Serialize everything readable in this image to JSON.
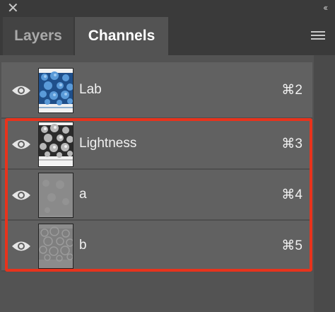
{
  "window": {
    "close_icon": "close-icon",
    "collapse_icon": "double-chevron-left-icon",
    "collapse_glyph": "‹‹"
  },
  "tabs": [
    {
      "label": "Layers",
      "active": false
    },
    {
      "label": "Channels",
      "active": true
    }
  ],
  "panel_menu_icon": "hamburger-menu-icon",
  "channels": [
    {
      "name": "Lab",
      "shortcut": "⌘2",
      "visible": true,
      "thumbnail": "color-blue-texture"
    },
    {
      "name": "Lightness",
      "shortcut": "⌘3",
      "visible": true,
      "thumbnail": "grayscale-texture"
    },
    {
      "name": "a",
      "shortcut": "⌘4",
      "visible": true,
      "thumbnail": "flat-gray-noise"
    },
    {
      "name": "b",
      "shortcut": "⌘5",
      "visible": true,
      "thumbnail": "flat-gray-pattern"
    }
  ],
  "highlight": {
    "color": "#e8331c",
    "covers_channels": [
      "Lightness",
      "a",
      "b"
    ]
  },
  "colors": {
    "panel_bg": "#535353",
    "row_bg": "#616161",
    "tabbar_bg": "#3a3a3a",
    "accent_red": "#e8331c"
  }
}
